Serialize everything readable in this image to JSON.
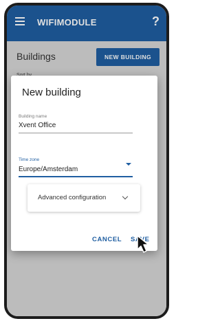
{
  "app": {
    "title": "WIFIMODULE",
    "menu_icon": "hamburger-icon",
    "help_icon": "help-icon",
    "help_symbol": "?",
    "accent_color": "#1f5ea1"
  },
  "page": {
    "title": "Buildings",
    "new_building_label": "NEW BUILDING",
    "sort_label": "Sort by"
  },
  "dialog": {
    "title": "New building",
    "building_name": {
      "label": "Building name",
      "value": "Xvent Office"
    },
    "time_zone": {
      "label": "Time zone",
      "value": "Europe/Amsterdam"
    },
    "advanced": {
      "label": "Advanced configuration",
      "icon": "chevron-down-icon"
    },
    "cancel_label": "CANCEL",
    "save_label": "SAVE"
  },
  "cursor_icon": "mouse-pointer-icon"
}
